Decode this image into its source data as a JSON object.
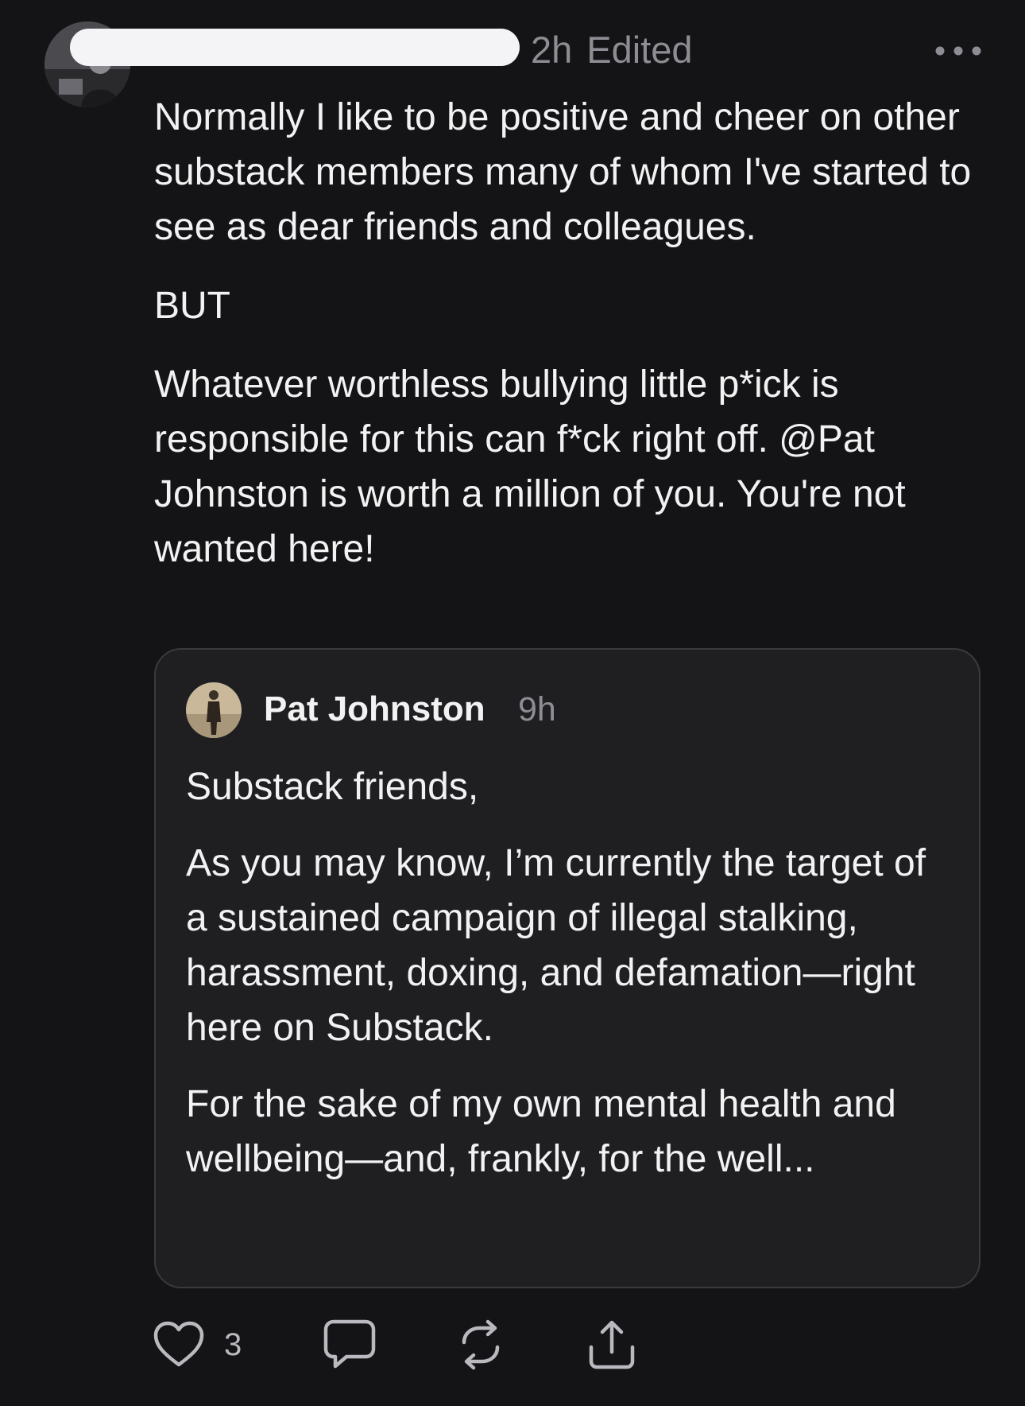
{
  "post": {
    "time": "2h",
    "edited_label": "Edited",
    "paragraphs": [
      "Normally I like to be positive and cheer on other substack members many of whom I've started to see as dear friends and colleagues.",
      "BUT",
      "Whatever worthless bullying little p*ick is responsible for this can f*ck right off. @Pat Johnston is worth a million of you. You're not wanted here!"
    ]
  },
  "quoted_note": {
    "author": "Pat Johnston",
    "time": "9h",
    "paragraphs": [
      "Substack friends,",
      "As you may know, I’m currently the target of a sustained campaign of illegal stalking, harassment, doxing, and defamation—right here on Substack.",
      "For the sake of my own mental health and wellbeing—and, frankly, for the well..."
    ]
  },
  "actions": {
    "like_count": "3",
    "icons": [
      "heart-icon",
      "comment-icon",
      "restack-icon",
      "share-icon"
    ]
  },
  "colors": {
    "background": "#141416",
    "card_background": "#1f1f22",
    "card_border": "#3a3a3e",
    "primary_text": "#f2f2f3",
    "secondary_text": "#8d8d93",
    "redaction": "#f4f4f6"
  }
}
